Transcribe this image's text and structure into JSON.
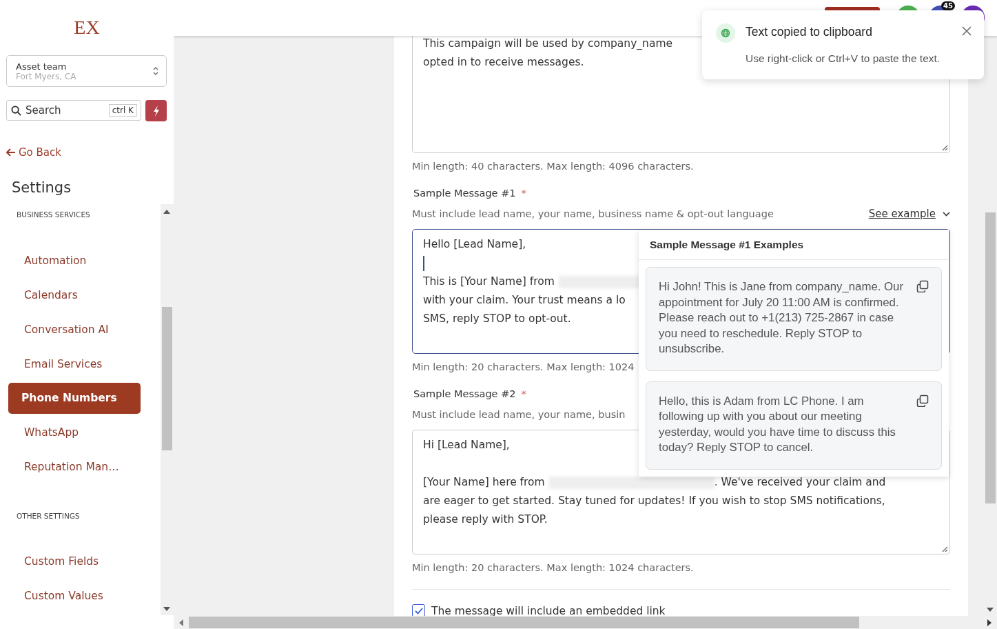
{
  "sidebar": {
    "logo": "EX",
    "location": {
      "name": "Asset team",
      "address": "Fort Myers, CA"
    },
    "search": {
      "placeholder": "Search",
      "shortcut": "ctrl K"
    },
    "back_link": "Go Back",
    "heading": "Settings",
    "sections": [
      {
        "title": "BUSINESS SERVICES",
        "items": [
          {
            "label": "Automation",
            "selected": false
          },
          {
            "label": "Calendars",
            "selected": false
          },
          {
            "label": "Conversation AI",
            "selected": false
          },
          {
            "label": "Email Services",
            "selected": false
          },
          {
            "label": "Phone Numbers",
            "selected": true
          },
          {
            "label": "WhatsApp",
            "selected": false
          },
          {
            "label": "Reputation Man…",
            "selected": false
          }
        ]
      },
      {
        "title": "OTHER SETTINGS",
        "items": [
          {
            "label": "Custom Fields",
            "selected": false
          },
          {
            "label": "Custom Values",
            "selected": false
          }
        ]
      }
    ]
  },
  "header": {
    "notification_count": "45"
  },
  "form": {
    "description": {
      "lines": [
        [
          {
            "kind": "text",
            "text": "This campaign will be used by company_name"
          }
        ],
        [
          {
            "kind": "text",
            "text": "opted in to receive messages."
          }
        ]
      ],
      "hint": "Min length: 40 characters. Max length: 4096 characters."
    },
    "samples": [
      {
        "label": "Sample Message #1",
        "required_mark": "*",
        "help": "Must include lead name, your name, business name & opt-out language",
        "see_example": "See example",
        "focused": true,
        "lines": [
          [
            {
              "kind": "text",
              "text": "Hello [Lead Name],"
            }
          ],
          [
            {
              "kind": "caret"
            }
          ],
          [
            {
              "kind": "text",
              "text": "This is [Your Name] from"
            },
            {
              "kind": "redacted"
            }
          ],
          [
            {
              "kind": "text",
              "text": "with your claim. Your trust means a lo"
            }
          ],
          [
            {
              "kind": "text",
              "text": "SMS, reply STOP to opt-out."
            }
          ]
        ],
        "hint": "Min length: 20 characters. Max length: 1024"
      },
      {
        "label": "Sample Message #2",
        "required_mark": "*",
        "help": "Must include lead name, your name, busin",
        "focused": false,
        "lines": [
          [
            {
              "kind": "text",
              "text": "Hi [Lead Name],"
            }
          ],
          [
            {
              "kind": "blank"
            }
          ],
          [
            {
              "kind": "text",
              "text": "[Your Name] here from"
            },
            {
              "kind": "redacted"
            },
            {
              "kind": "text",
              "text": ". We've received your claim and"
            }
          ],
          [
            {
              "kind": "text",
              "text": "are eager to get started. Stay tuned for updates! If you wish to stop SMS notifications,"
            }
          ],
          [
            {
              "kind": "text",
              "text": "please reply with STOP."
            }
          ]
        ],
        "hint": "Min length: 20 characters. Max length: 1024 characters."
      }
    ],
    "checkbox": {
      "label": "The message will include an embedded link",
      "checked": true
    }
  },
  "examples_popover": {
    "title": "Sample Message #1 Examples",
    "examples": [
      "Hi John! This is Jane from company_name. Our appointment for July 20 11:00 AM is confirmed. Please reach out to +1(213) 725-2867 in case you need to reschedule. Reply STOP to unsubscribe.",
      "Hello, this is Adam from LC Phone. I am following up with you about our meeting yesterday, would you have time to discuss this today? Reply STOP to cancel."
    ]
  },
  "toast": {
    "title": "Text copied to clipboard",
    "message": "Use right-click or Ctrl+V to paste the text."
  }
}
